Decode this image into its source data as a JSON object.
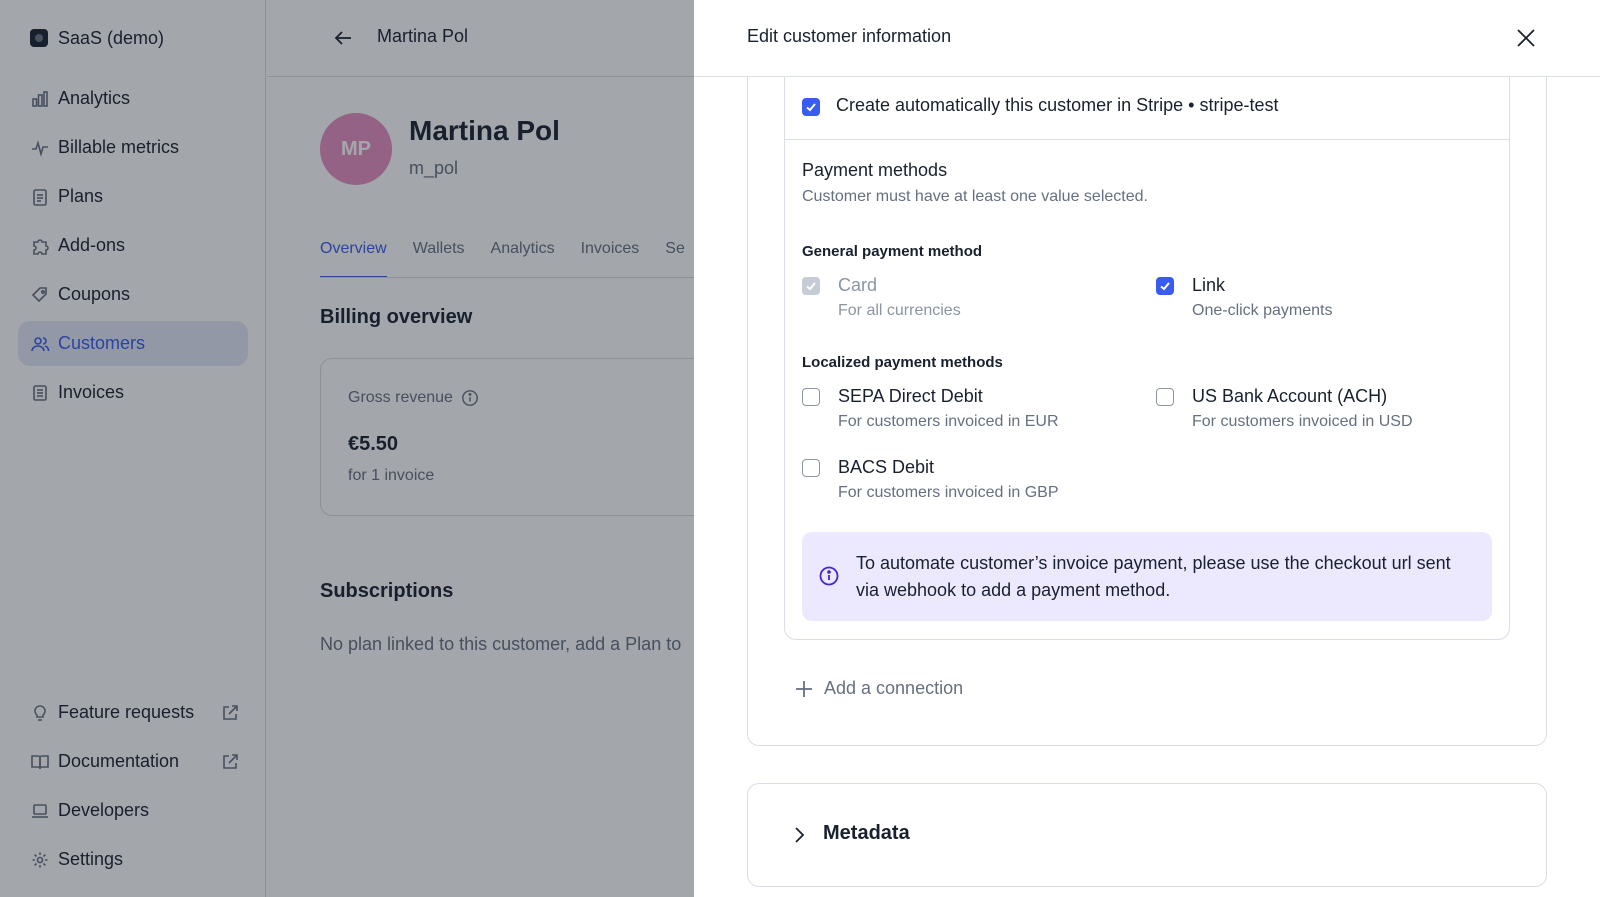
{
  "sidebar": {
    "org_name": "SaaS (demo)",
    "items": [
      {
        "label": "Analytics",
        "icon": "bar-chart-icon"
      },
      {
        "label": "Billable metrics",
        "icon": "pulse-icon"
      },
      {
        "label": "Plans",
        "icon": "clipboard-icon"
      },
      {
        "label": "Add-ons",
        "icon": "puzzle-icon"
      },
      {
        "label": "Coupons",
        "icon": "tag-icon"
      },
      {
        "label": "Customers",
        "icon": "users-icon",
        "active": true
      },
      {
        "label": "Invoices",
        "icon": "document-icon"
      }
    ],
    "bottom_items": [
      {
        "label": "Feature requests",
        "icon": "lightbulb-icon",
        "external": true
      },
      {
        "label": "Documentation",
        "icon": "book-icon",
        "external": true
      },
      {
        "label": "Developers",
        "icon": "laptop-icon"
      },
      {
        "label": "Settings",
        "icon": "gear-icon"
      }
    ]
  },
  "customer": {
    "breadcrumb_name": "Martina Pol",
    "initials": "MP",
    "name": "Martina Pol",
    "external_id": "m_pol",
    "tabs": [
      "Overview",
      "Wallets",
      "Analytics",
      "Invoices",
      "Se"
    ],
    "active_tab": "Overview",
    "billing_title": "Billing overview",
    "gross_revenue": {
      "label": "Gross revenue",
      "value": "€5.50",
      "sub": "for 1 invoice"
    },
    "subscriptions_title": "Subscriptions",
    "subscriptions_empty": "No plan linked to this customer, add a Plan to"
  },
  "drawer": {
    "title": "Edit customer information",
    "auto_create": {
      "label": "Create automatically this customer in Stripe • stripe-test",
      "checked": true
    },
    "payment_methods": {
      "title": "Payment methods",
      "subtitle": "Customer must have at least one value selected.",
      "general_label": "General payment method",
      "general": [
        {
          "label": "Card",
          "desc": "For all currencies",
          "checked": true,
          "disabled": true
        },
        {
          "label": "Link",
          "desc": "One-click payments",
          "checked": true,
          "disabled": false
        }
      ],
      "localized_label": "Localized payment methods",
      "localized": [
        {
          "label": "SEPA Direct Debit",
          "desc": "For customers invoiced in EUR",
          "checked": false
        },
        {
          "label": "US Bank Account (ACH)",
          "desc": "For customers invoiced in USD",
          "checked": false
        },
        {
          "label": "BACS Debit",
          "desc": "For customers invoiced in GBP",
          "checked": false
        }
      ]
    },
    "info_banner": "To automate customer’s invoice payment, please use the checkout url sent via webhook to add a payment method.",
    "add_connection": "Add a connection",
    "metadata_title": "Metadata"
  },
  "colors": {
    "accent": "#385bf0",
    "info_bg": "#ece8fe",
    "avatar": "#e48ec0"
  }
}
